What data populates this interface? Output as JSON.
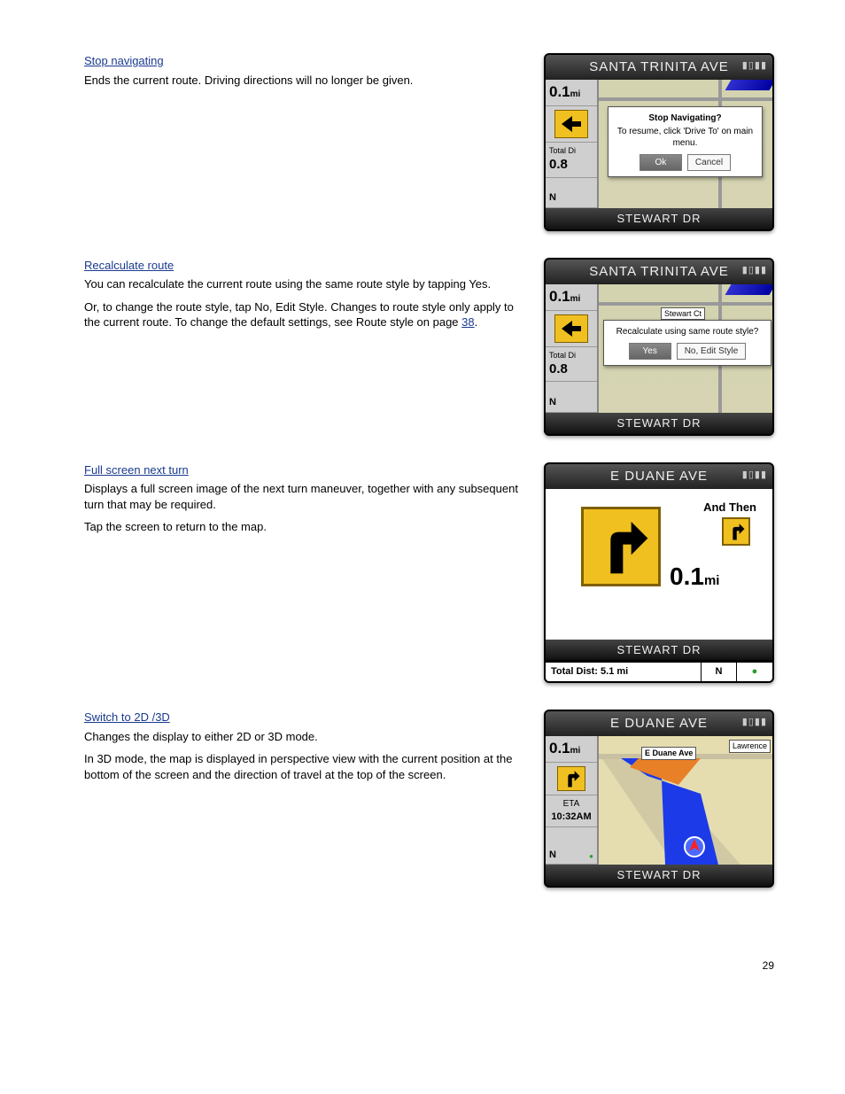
{
  "sections": {
    "stop": {
      "heading": "Stop navigating",
      "paragraphs": [
        "Ends the current route. Driving directions will no longer be given."
      ]
    },
    "recalc": {
      "heading": "Recalculate route",
      "paragraphs": [
        "You can recalculate the current route using the same route style by tapping Yes.",
        "Or, to change the route style, tap No, Edit Style. Changes to route style only apply to the current route. To change the default settings, see Route style on page "
      ],
      "page_ref": "38",
      "suffix": "."
    },
    "fullscreen": {
      "heading": "Full screen next turn",
      "paragraphs": [
        "Displays a full screen image of the next turn maneuver, together with any subsequent turn that may be required.",
        "Tap the screen to return to the map."
      ]
    },
    "switch": {
      "heading": "Switch to 2D /3D",
      "paragraphs": [
        "Changes the display to either 2D or 3D mode.",
        "In 3D mode, the map is displayed in perspective view with the current position at the bottom of the screen and the direction of travel at the top of the screen."
      ]
    }
  },
  "screens": {
    "s1": {
      "top_title": "SANTA TRINITA AVE",
      "bottom_title": "STEWART DR",
      "dist": "0.1",
      "dist_unit": "mi",
      "total_label": "Total Di",
      "total_val": "0.8",
      "compass": "N",
      "dialog_title": "Stop Navigating?",
      "dialog_body": "To resume, click 'Drive To' on main menu.",
      "btn_ok": "Ok",
      "btn_cancel": "Cancel"
    },
    "s2": {
      "top_title": "SANTA TRINITA AVE",
      "bottom_title": "STEWART DR",
      "dist": "0.1",
      "dist_unit": "mi",
      "total_label": "Total Di",
      "total_val": "0.8",
      "compass": "N",
      "road_label": "Stewart Ct",
      "dialog_body": "Recalculate using same route style?",
      "btn_yes": "Yes",
      "btn_no": "No, Edit Style"
    },
    "s3": {
      "top_title": "E DUANE AVE",
      "bottom_title": "STEWART DR",
      "dist": "0.1",
      "dist_unit": "mi",
      "and_then": "And Then",
      "status_total": "Total Dist: 5.1 mi",
      "status_compass": "N"
    },
    "s4": {
      "top_title": "E DUANE AVE",
      "bottom_title": "STEWART DR",
      "dist": "0.1",
      "dist_unit": "mi",
      "eta_label": "ETA",
      "eta_val": "10:32AM",
      "compass": "N",
      "road_label1": "E Duane Ave",
      "road_label2": "Lawrence"
    }
  },
  "page_number": "29"
}
